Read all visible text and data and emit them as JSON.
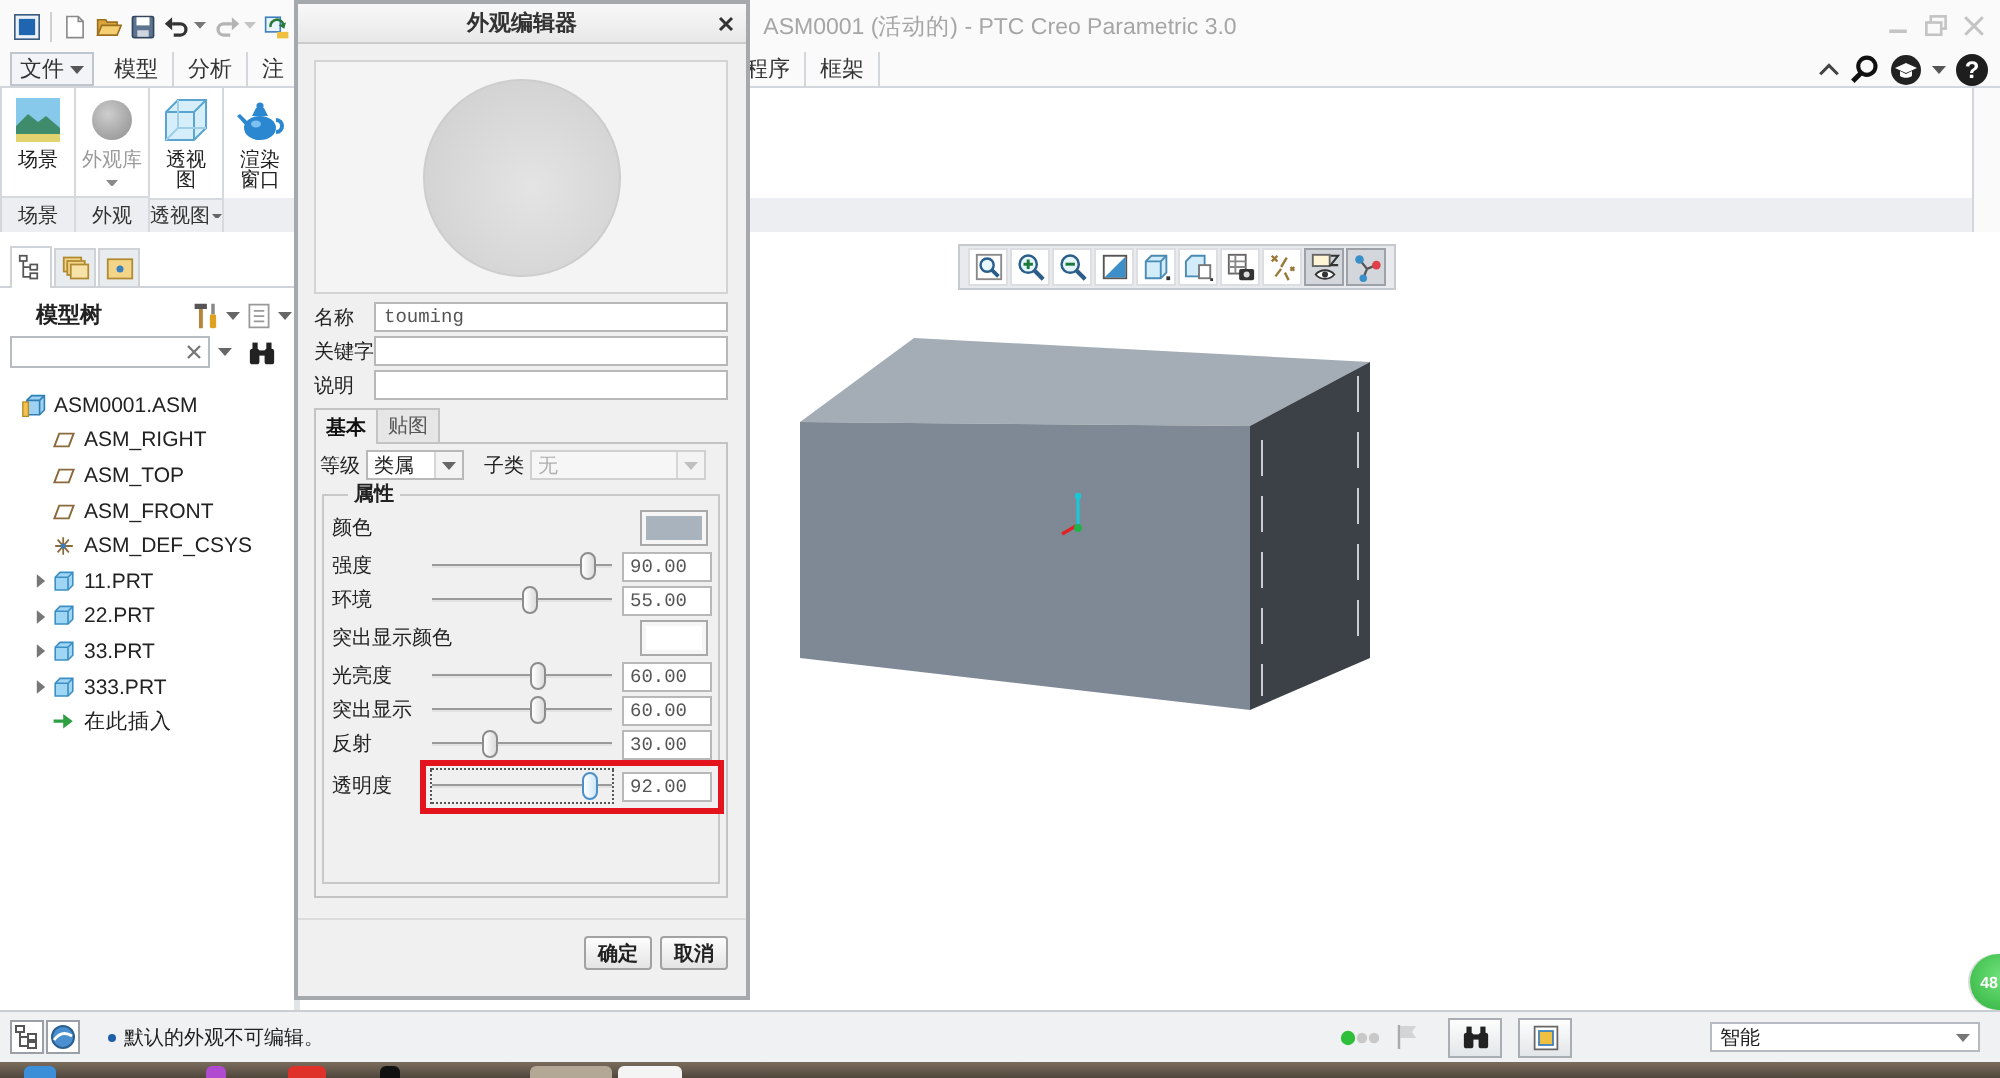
{
  "window": {
    "title": "ASM0001 (活动的) - PTC Creo Parametric 3.0"
  },
  "quick_access_toolbar": [
    {
      "disabled": false,
      "dropdown": false
    },
    {
      "disabled": false,
      "dropdown": false
    },
    {
      "disabled": false,
      "dropdown": false
    },
    {
      "disabled": false,
      "dropdown": true
    },
    {
      "disabled": true,
      "dropdown": true
    },
    {
      "disabled": false,
      "dropdown": false
    }
  ],
  "ribbon": {
    "tabs": [
      {
        "label": "文件",
        "kind": "menu",
        "selected": false
      },
      {
        "label": "模型",
        "kind": "tab",
        "selected": false
      },
      {
        "label": "分析",
        "kind": "tab",
        "selected": false
      },
      {
        "label": "注",
        "kind": "tab",
        "selected": false
      },
      {
        "label": "程序",
        "kind": "tab",
        "selected": false
      },
      {
        "label": "框架",
        "kind": "tab",
        "selected": false
      }
    ],
    "help_button": "?",
    "groups": [
      {
        "label": "场景",
        "dropdown": false,
        "commands": [
          {
            "label": "场景",
            "disabled": false,
            "dropdown": false
          }
        ]
      },
      {
        "label": "外观",
        "dropdown": false,
        "commands": [
          {
            "label": "外观库",
            "disabled": true,
            "dropdown": true
          }
        ]
      },
      {
        "label": "透视图",
        "dropdown": true,
        "commands": [
          {
            "label": "透视图",
            "disabled": false,
            "dropdown": false
          }
        ]
      },
      {
        "commands": [
          {
            "label": "渲染窗口",
            "disabled": false,
            "dropdown": false
          }
        ]
      }
    ]
  },
  "model_tree": {
    "tabs": [
      {
        "selected": true
      },
      {
        "selected": false
      },
      {
        "selected": false
      }
    ],
    "title": "模型树",
    "items": [
      {
        "label": "ASM0001.ASM",
        "kind": "assembly",
        "children": [
          {
            "label": "ASM_RIGHT",
            "kind": "plane"
          },
          {
            "label": "ASM_TOP",
            "kind": "plane"
          },
          {
            "label": "ASM_FRONT",
            "kind": "plane"
          },
          {
            "label": "ASM_DEF_CSYS",
            "kind": "csys"
          },
          {
            "label": "11.PRT",
            "kind": "part",
            "expanded": false
          },
          {
            "label": "22.PRT",
            "kind": "part",
            "expanded": false
          },
          {
            "label": "33.PRT",
            "kind": "part",
            "expanded": false
          },
          {
            "label": "333.PRT",
            "kind": "part",
            "expanded": false
          },
          {
            "label": "在此插入",
            "kind": "insert"
          }
        ]
      }
    ]
  },
  "view_toolbar": [
    {
      "on": false
    },
    {
      "on": false
    },
    {
      "on": false
    },
    {
      "on": false
    },
    {
      "on": false
    },
    {
      "on": false
    },
    {
      "on": false
    },
    {
      "on": false
    },
    {
      "on": true
    },
    {
      "on": true
    }
  ],
  "dialog": {
    "title": "外观编辑器",
    "fields": [
      {
        "label": "名称",
        "value": "touming"
      },
      {
        "label": "关键字"
      },
      {
        "label": "说明"
      }
    ],
    "tabs": [
      {
        "label": "基本",
        "selected": true
      },
      {
        "label": "贴图",
        "selected": false
      }
    ],
    "selectors": [
      {
        "label": "等级",
        "value": "类属",
        "disabled": false
      },
      {
        "label": "子类",
        "value": "无",
        "disabled": true
      }
    ],
    "group_title": "属性",
    "properties": [
      {
        "kind": "color",
        "label": "颜色",
        "color": "#a9b3be"
      },
      {
        "kind": "slider",
        "label": "强度",
        "level": 0.9,
        "value": "90.00",
        "focused": false,
        "highlighted": false
      },
      {
        "kind": "slider",
        "label": "环境",
        "level": 0.55,
        "value": "55.00",
        "focused": false,
        "highlighted": false
      },
      {
        "kind": "color",
        "label": "突出显示颜色",
        "color": "#ffffff"
      },
      {
        "kind": "slider",
        "label": "光亮度",
        "level": 0.6,
        "value": "60.00",
        "focused": false,
        "highlighted": false
      },
      {
        "kind": "slider",
        "label": "突出显示",
        "level": 0.6,
        "value": "60.00",
        "focused": false,
        "highlighted": false
      },
      {
        "kind": "slider",
        "label": "反射",
        "level": 0.3,
        "value": "30.00",
        "focused": false,
        "highlighted": false
      },
      {
        "kind": "slider",
        "label": "透明度",
        "level": 0.92,
        "value": "92.00",
        "focused": true,
        "highlighted": true
      }
    ],
    "buttons": [
      "确定",
      "取消"
    ]
  },
  "status_bar": {
    "message": "默认的外观不可编辑。",
    "filter": "智能"
  },
  "floating_ball": {
    "label": "48"
  }
}
